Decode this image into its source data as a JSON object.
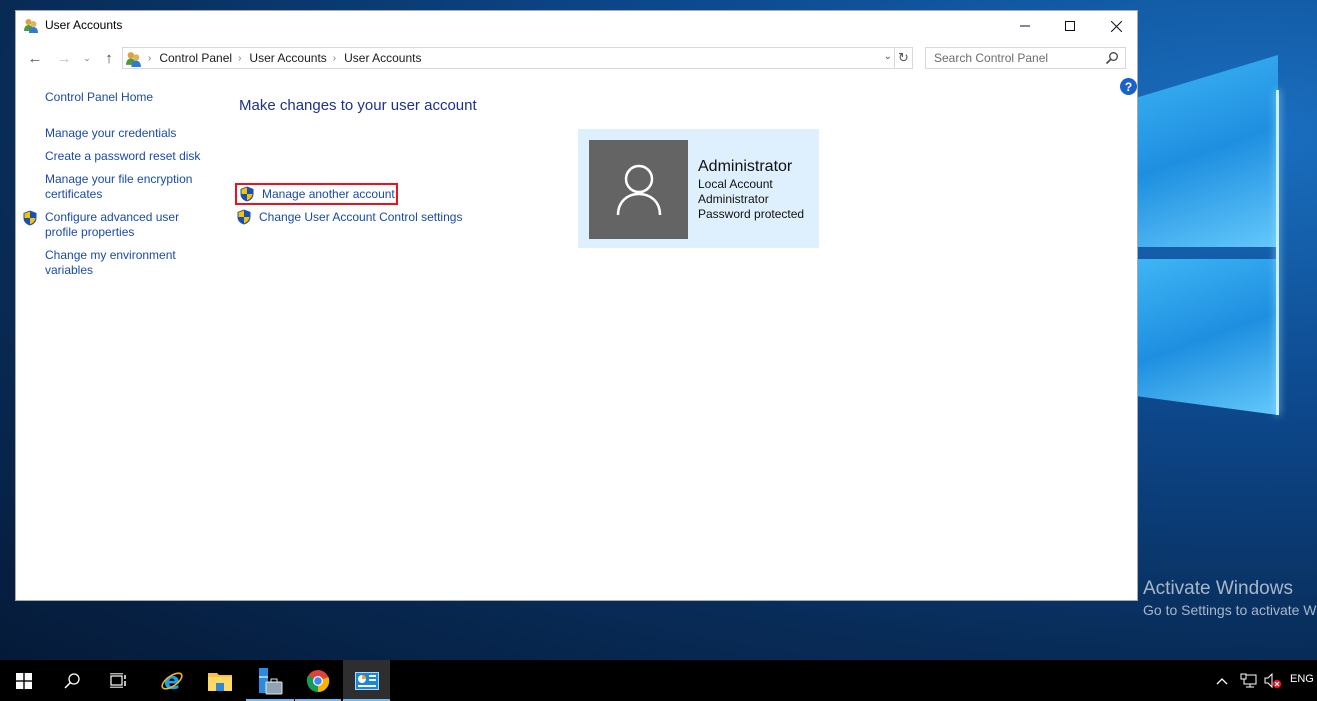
{
  "window": {
    "title": "User Accounts",
    "controls": {
      "minimize": "minimize",
      "maximize": "maximize",
      "close": "close"
    }
  },
  "navigation": {
    "breadcrumb": [
      "Control Panel",
      "User Accounts",
      "User Accounts"
    ],
    "search_placeholder": "Search Control Panel"
  },
  "sidebar": {
    "home": "Control Panel Home",
    "items": [
      {
        "label": "Manage your credentials",
        "shield": false
      },
      {
        "label": "Create a password reset disk",
        "shield": false
      },
      {
        "label": "Manage your file encryption certificates",
        "shield": false
      },
      {
        "label": "Configure advanced user profile properties",
        "shield": true
      },
      {
        "label": "Change my environment variables",
        "shield": false
      }
    ]
  },
  "main": {
    "heading": "Make changes to your user account",
    "tasks": [
      {
        "label": "Manage another account",
        "highlighted": true
      },
      {
        "label": "Change User Account Control settings",
        "highlighted": false
      }
    ],
    "account": {
      "name": "Administrator",
      "type": "Local Account",
      "role": "Administrator",
      "status": "Password protected"
    }
  },
  "desktop": {
    "watermark_title": "Activate Windows",
    "watermark_subtitle": "Go to Settings to activate Windows."
  },
  "taskbar": {
    "items": [
      "start",
      "search",
      "task-view",
      "internet-explorer",
      "file-explorer",
      "server-manager",
      "chrome",
      "control-panel"
    ],
    "language": "ENG"
  },
  "colors": {
    "link": "#1a4aa5",
    "heading": "#1e3287",
    "highlight": "#e8141c",
    "card_bg": "#def0fd",
    "avatar_bg": "#646464"
  }
}
